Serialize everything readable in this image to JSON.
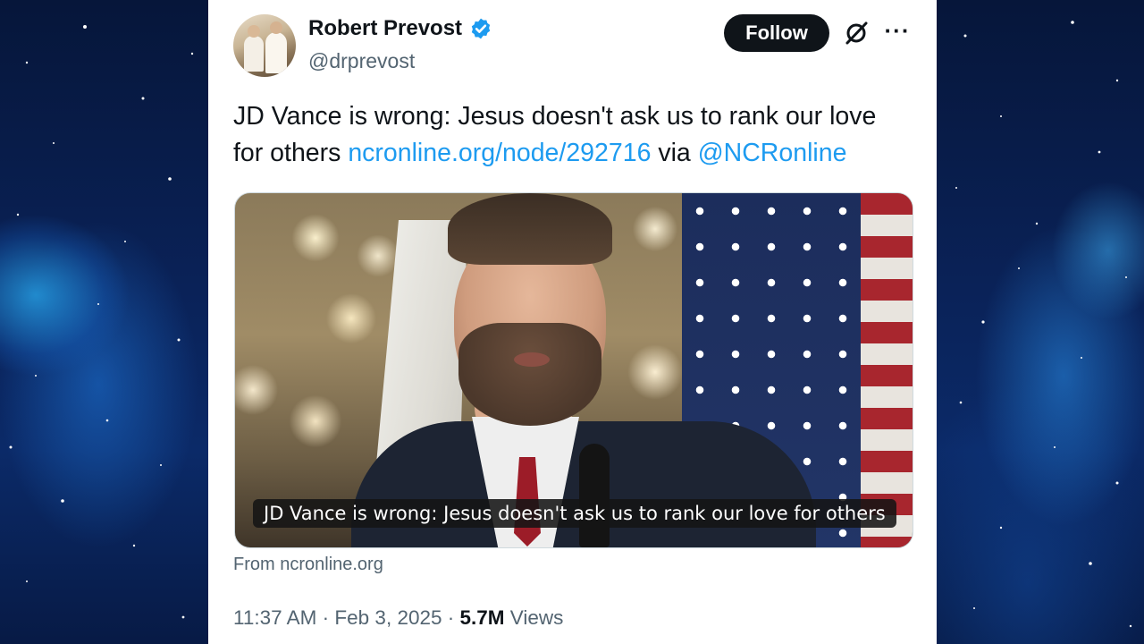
{
  "tweet": {
    "author": {
      "display_name": "Robert Prevost",
      "handle": "@drprevost",
      "verified": true,
      "verified_color": "#1d9bf0"
    },
    "actions": {
      "follow_label": "Follow",
      "grok_icon": "grok-icon",
      "more_icon": "more-options-icon",
      "more_glyph": "···"
    },
    "text": {
      "main": "JD Vance is wrong: Jesus doesn't ask us to rank our love for others ",
      "link": "ncronline.org/node/292716",
      "via": " via ",
      "mention": "@NCRonline"
    },
    "media": {
      "caption": "JD Vance is wrong: Jesus doesn't ask us to rank our love for others",
      "source": "From ncronline.org"
    },
    "meta": {
      "time": "11:37 AM",
      "separator": " · ",
      "date": "Feb 3, 2025",
      "views_count": "5.7M",
      "views_label": " Views"
    }
  },
  "colors": {
    "text_primary": "#0f1419",
    "text_secondary": "#536471",
    "link": "#1d9bf0",
    "background": "#0a2258"
  }
}
